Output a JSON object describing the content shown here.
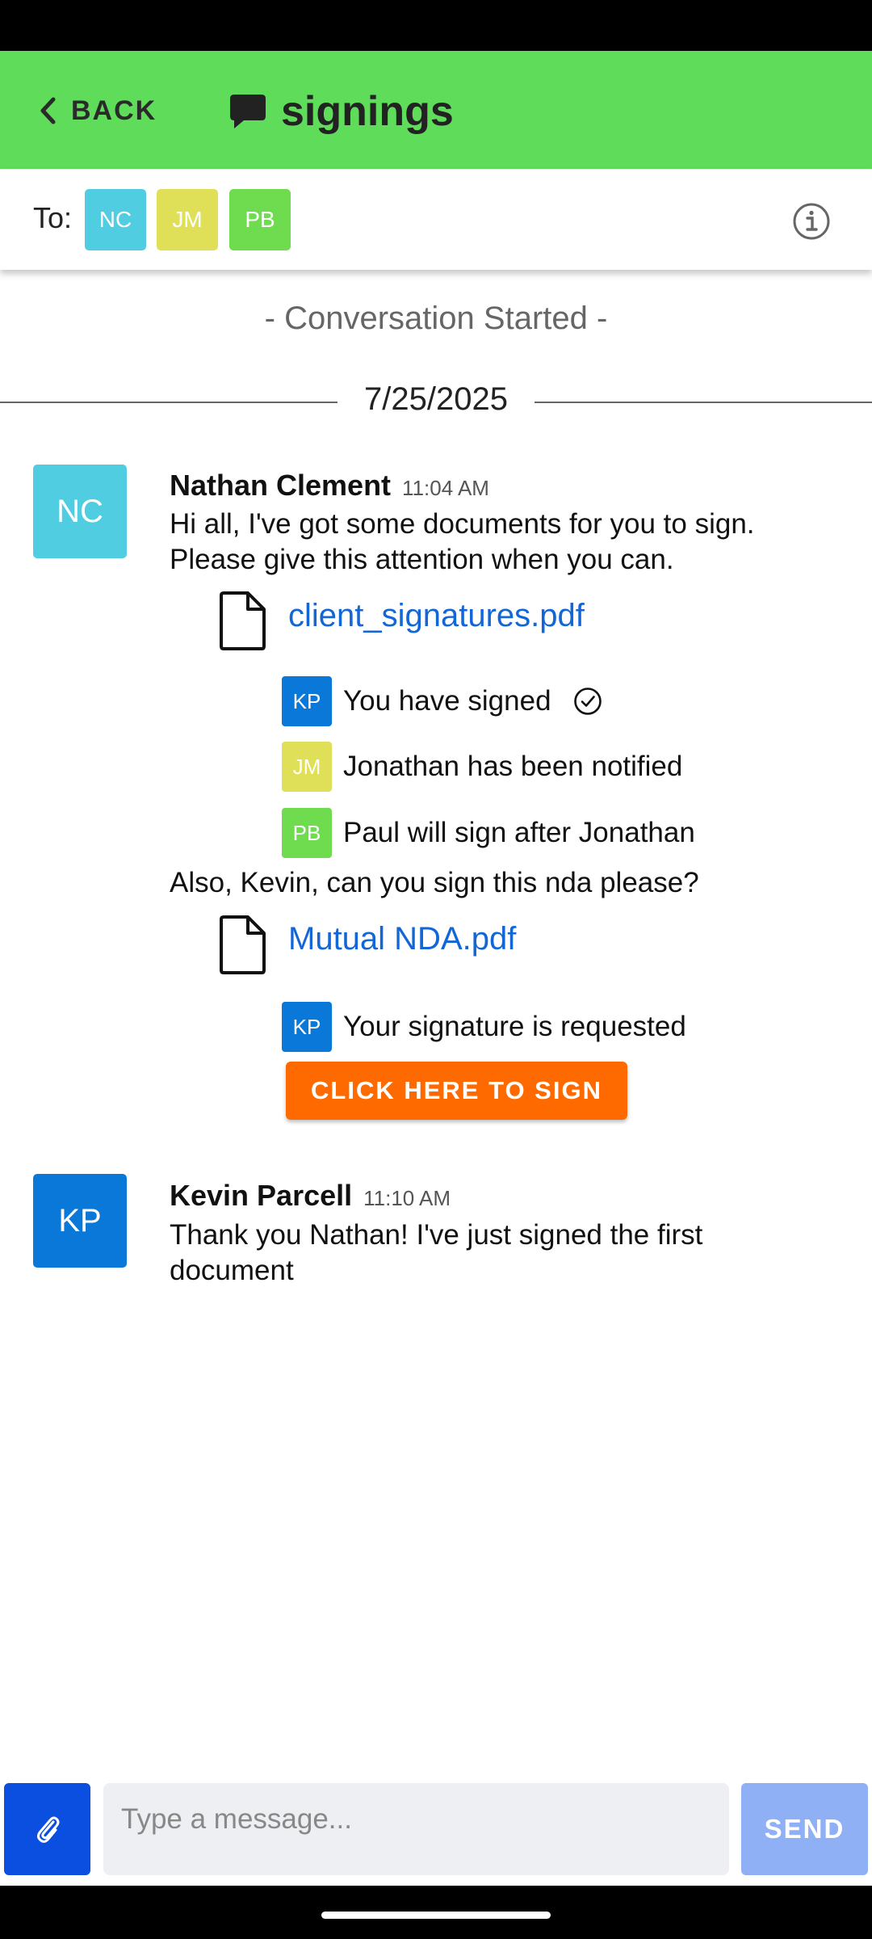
{
  "header": {
    "back_label": "BACK",
    "title": "signings",
    "background": "#5fdd5a"
  },
  "recipients": {
    "label": "To:",
    "chips": [
      {
        "initials": "NC",
        "color": "#50cde0"
      },
      {
        "initials": "JM",
        "color": "#dfe058"
      },
      {
        "initials": "PB",
        "color": "#6fdc4f"
      }
    ],
    "info_icon": "info-icon"
  },
  "conversation": {
    "started_text": "- Conversation Started -",
    "date": "7/25/2025"
  },
  "messages": [
    {
      "avatar": {
        "initials": "NC",
        "color": "#50cde0"
      },
      "sender": "Nathan Clement",
      "time": "11:04 AM",
      "text_lines": [
        "Hi all, I've got some documents for you to sign.",
        "Please give this attention when you can."
      ],
      "attachment": {
        "file_name": "client_signatures.pdf",
        "icon": "file-icon",
        "signatures": [
          {
            "initials": "KP",
            "color": "#0a78d8",
            "text": "You have signed",
            "icon": "check-circle-icon"
          },
          {
            "initials": "JM",
            "color": "#dfe058",
            "text": "Jonathan has been notified"
          },
          {
            "initials": "PB",
            "color": "#6fdc4f",
            "text": "Paul will sign after Jonathan"
          }
        ]
      },
      "followup_text": "Also, Kevin, can you sign this nda please?",
      "attachment2": {
        "file_name": "Mutual NDA.pdf",
        "icon": "file-icon",
        "signatures": [
          {
            "initials": "KP",
            "color": "#0a78d8",
            "text": "Your signature is requested"
          }
        ],
        "action_label": "CLICK HERE TO SIGN",
        "action_color": "#ff6a00"
      }
    },
    {
      "avatar": {
        "initials": "KP",
        "color": "#0a78d8"
      },
      "sender": "Kevin Parcell",
      "time": "11:10 AM",
      "text_lines": [
        "Thank you Nathan!  I've just signed the first",
        "document"
      ]
    }
  ],
  "composer": {
    "attach_icon": "paperclip-icon",
    "placeholder": "Type a message...",
    "send_label": "SEND"
  }
}
